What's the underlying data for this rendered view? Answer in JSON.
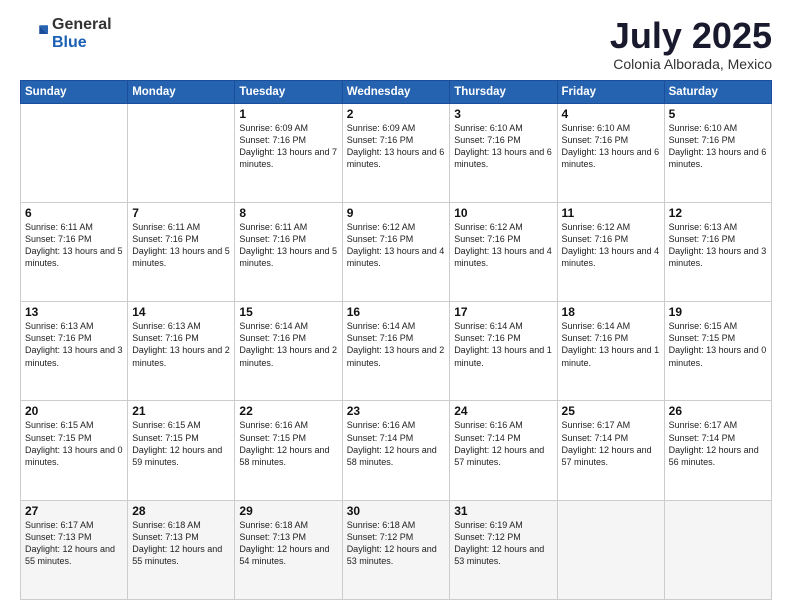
{
  "logo": {
    "general": "General",
    "blue": "Blue"
  },
  "title": "July 2025",
  "subtitle": "Colonia Alborada, Mexico",
  "header_days": [
    "Sunday",
    "Monday",
    "Tuesday",
    "Wednesday",
    "Thursday",
    "Friday",
    "Saturday"
  ],
  "weeks": [
    [
      {
        "day": "",
        "info": ""
      },
      {
        "day": "",
        "info": ""
      },
      {
        "day": "1",
        "info": "Sunrise: 6:09 AM\nSunset: 7:16 PM\nDaylight: 13 hours\nand 7 minutes."
      },
      {
        "day": "2",
        "info": "Sunrise: 6:09 AM\nSunset: 7:16 PM\nDaylight: 13 hours\nand 6 minutes."
      },
      {
        "day": "3",
        "info": "Sunrise: 6:10 AM\nSunset: 7:16 PM\nDaylight: 13 hours\nand 6 minutes."
      },
      {
        "day": "4",
        "info": "Sunrise: 6:10 AM\nSunset: 7:16 PM\nDaylight: 13 hours\nand 6 minutes."
      },
      {
        "day": "5",
        "info": "Sunrise: 6:10 AM\nSunset: 7:16 PM\nDaylight: 13 hours\nand 6 minutes."
      }
    ],
    [
      {
        "day": "6",
        "info": "Sunrise: 6:11 AM\nSunset: 7:16 PM\nDaylight: 13 hours\nand 5 minutes."
      },
      {
        "day": "7",
        "info": "Sunrise: 6:11 AM\nSunset: 7:16 PM\nDaylight: 13 hours\nand 5 minutes."
      },
      {
        "day": "8",
        "info": "Sunrise: 6:11 AM\nSunset: 7:16 PM\nDaylight: 13 hours\nand 5 minutes."
      },
      {
        "day": "9",
        "info": "Sunrise: 6:12 AM\nSunset: 7:16 PM\nDaylight: 13 hours\nand 4 minutes."
      },
      {
        "day": "10",
        "info": "Sunrise: 6:12 AM\nSunset: 7:16 PM\nDaylight: 13 hours\nand 4 minutes."
      },
      {
        "day": "11",
        "info": "Sunrise: 6:12 AM\nSunset: 7:16 PM\nDaylight: 13 hours\nand 4 minutes."
      },
      {
        "day": "12",
        "info": "Sunrise: 6:13 AM\nSunset: 7:16 PM\nDaylight: 13 hours\nand 3 minutes."
      }
    ],
    [
      {
        "day": "13",
        "info": "Sunrise: 6:13 AM\nSunset: 7:16 PM\nDaylight: 13 hours\nand 3 minutes."
      },
      {
        "day": "14",
        "info": "Sunrise: 6:13 AM\nSunset: 7:16 PM\nDaylight: 13 hours\nand 2 minutes."
      },
      {
        "day": "15",
        "info": "Sunrise: 6:14 AM\nSunset: 7:16 PM\nDaylight: 13 hours\nand 2 minutes."
      },
      {
        "day": "16",
        "info": "Sunrise: 6:14 AM\nSunset: 7:16 PM\nDaylight: 13 hours\nand 2 minutes."
      },
      {
        "day": "17",
        "info": "Sunrise: 6:14 AM\nSunset: 7:16 PM\nDaylight: 13 hours\nand 1 minute."
      },
      {
        "day": "18",
        "info": "Sunrise: 6:14 AM\nSunset: 7:16 PM\nDaylight: 13 hours\nand 1 minute."
      },
      {
        "day": "19",
        "info": "Sunrise: 6:15 AM\nSunset: 7:15 PM\nDaylight: 13 hours\nand 0 minutes."
      }
    ],
    [
      {
        "day": "20",
        "info": "Sunrise: 6:15 AM\nSunset: 7:15 PM\nDaylight: 13 hours\nand 0 minutes."
      },
      {
        "day": "21",
        "info": "Sunrise: 6:15 AM\nSunset: 7:15 PM\nDaylight: 12 hours\nand 59 minutes."
      },
      {
        "day": "22",
        "info": "Sunrise: 6:16 AM\nSunset: 7:15 PM\nDaylight: 12 hours\nand 58 minutes."
      },
      {
        "day": "23",
        "info": "Sunrise: 6:16 AM\nSunset: 7:14 PM\nDaylight: 12 hours\nand 58 minutes."
      },
      {
        "day": "24",
        "info": "Sunrise: 6:16 AM\nSunset: 7:14 PM\nDaylight: 12 hours\nand 57 minutes."
      },
      {
        "day": "25",
        "info": "Sunrise: 6:17 AM\nSunset: 7:14 PM\nDaylight: 12 hours\nand 57 minutes."
      },
      {
        "day": "26",
        "info": "Sunrise: 6:17 AM\nSunset: 7:14 PM\nDaylight: 12 hours\nand 56 minutes."
      }
    ],
    [
      {
        "day": "27",
        "info": "Sunrise: 6:17 AM\nSunset: 7:13 PM\nDaylight: 12 hours\nand 55 minutes."
      },
      {
        "day": "28",
        "info": "Sunrise: 6:18 AM\nSunset: 7:13 PM\nDaylight: 12 hours\nand 55 minutes."
      },
      {
        "day": "29",
        "info": "Sunrise: 6:18 AM\nSunset: 7:13 PM\nDaylight: 12 hours\nand 54 minutes."
      },
      {
        "day": "30",
        "info": "Sunrise: 6:18 AM\nSunset: 7:12 PM\nDaylight: 12 hours\nand 53 minutes."
      },
      {
        "day": "31",
        "info": "Sunrise: 6:19 AM\nSunset: 7:12 PM\nDaylight: 12 hours\nand 53 minutes."
      },
      {
        "day": "",
        "info": ""
      },
      {
        "day": "",
        "info": ""
      }
    ]
  ]
}
